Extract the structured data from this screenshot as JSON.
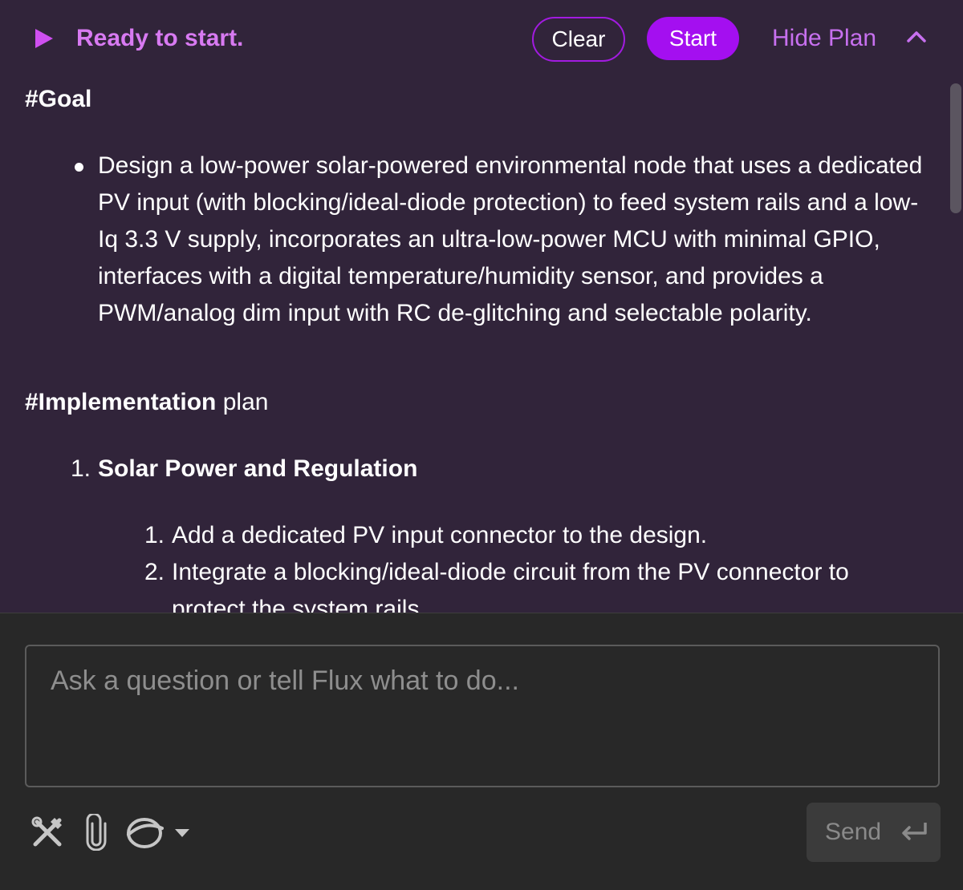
{
  "header": {
    "status_text": "Ready to start.",
    "clear_label": "Clear",
    "start_label": "Start",
    "hide_plan_label": "Hide Plan"
  },
  "plan": {
    "goal_heading": "#Goal",
    "goal_text": "Design a low-power solar-powered environmental node that uses a dedicated PV input (with blocking/ideal-diode protection) to feed system rails and a low-Iq 3.3 V supply, incorporates an ultra-low-power MCU with minimal GPIO, interfaces with a digital temperature/humidity sensor, and provides a PWM/analog dim input with RC de-glitching and selectable polarity.",
    "implementation_heading": "#Implementation",
    "implementation_suffix": "plan",
    "sections": [
      {
        "number": "1.",
        "title": "Solar Power and Regulation",
        "steps": [
          {
            "number": "1.",
            "text": "Add a dedicated PV input connector to the design."
          },
          {
            "number": "2.",
            "text": "Integrate a blocking/ideal-diode circuit from the PV connector to",
            "continuation": "protect the system rails."
          }
        ]
      }
    ]
  },
  "composer": {
    "placeholder": "Ask a question or tell Flux what to do...",
    "send_label": "Send"
  },
  "icons": {
    "status": "play-icon",
    "collapse": "chevron-up-icon",
    "tools": "tools-icon",
    "attach": "paperclip-icon",
    "model": "model-icon",
    "send": "enter-icon"
  },
  "colors": {
    "accent": "#a40ff0",
    "accent_text": "#d87af2",
    "panel_bg": "#31243a",
    "composer_bg": "#282828"
  }
}
